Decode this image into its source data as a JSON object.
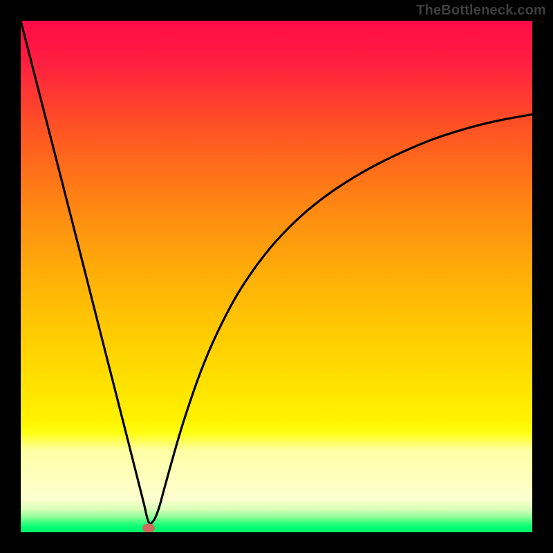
{
  "watermark": "TheBottleneck.com",
  "chart_data": {
    "type": "line",
    "title": "",
    "xlabel": "",
    "ylabel": "",
    "xlim": [
      0,
      100
    ],
    "ylim": [
      0,
      100
    ],
    "grid": false,
    "background_gradient": {
      "stops": [
        {
          "pos": 0.0,
          "color": "#ff0b49"
        },
        {
          "pos": 0.08,
          "color": "#ff1e40"
        },
        {
          "pos": 0.2,
          "color": "#ff4f25"
        },
        {
          "pos": 0.35,
          "color": "#ff8314"
        },
        {
          "pos": 0.5,
          "color": "#ffb008"
        },
        {
          "pos": 0.65,
          "color": "#ffd401"
        },
        {
          "pos": 0.78,
          "color": "#fff200"
        },
        {
          "pos": 0.805,
          "color": "#ffff10"
        },
        {
          "pos": 0.84,
          "color": "#ffffa5"
        },
        {
          "pos": 0.935,
          "color": "#fdffd0"
        },
        {
          "pos": 0.955,
          "color": "#d9ffb8"
        },
        {
          "pos": 0.968,
          "color": "#9cff9d"
        },
        {
          "pos": 0.978,
          "color": "#4eff84"
        },
        {
          "pos": 0.99,
          "color": "#00ff73"
        },
        {
          "pos": 1.0,
          "color": "#00f06a"
        }
      ]
    },
    "series": [
      {
        "name": "bottleneck-curve",
        "x": [
          0,
          5,
          10,
          15,
          20,
          22,
          24,
          25,
          26,
          27,
          28,
          30,
          32,
          35,
          38,
          42,
          46,
          50,
          55,
          60,
          65,
          70,
          75,
          80,
          85,
          90,
          95,
          100
        ],
        "y": [
          100,
          80.5,
          61,
          41.3,
          21.7,
          13.8,
          5.9,
          2,
          2.3,
          4.7,
          8.3,
          15.5,
          22.2,
          30.9,
          38.1,
          45.9,
          52,
          57,
          62,
          66,
          69.3,
          72.1,
          74.5,
          76.6,
          78.3,
          79.7,
          80.8,
          81.7
        ]
      }
    ],
    "marker": {
      "x": 25,
      "y": 0.8,
      "color": "#cd6a5d"
    }
  }
}
